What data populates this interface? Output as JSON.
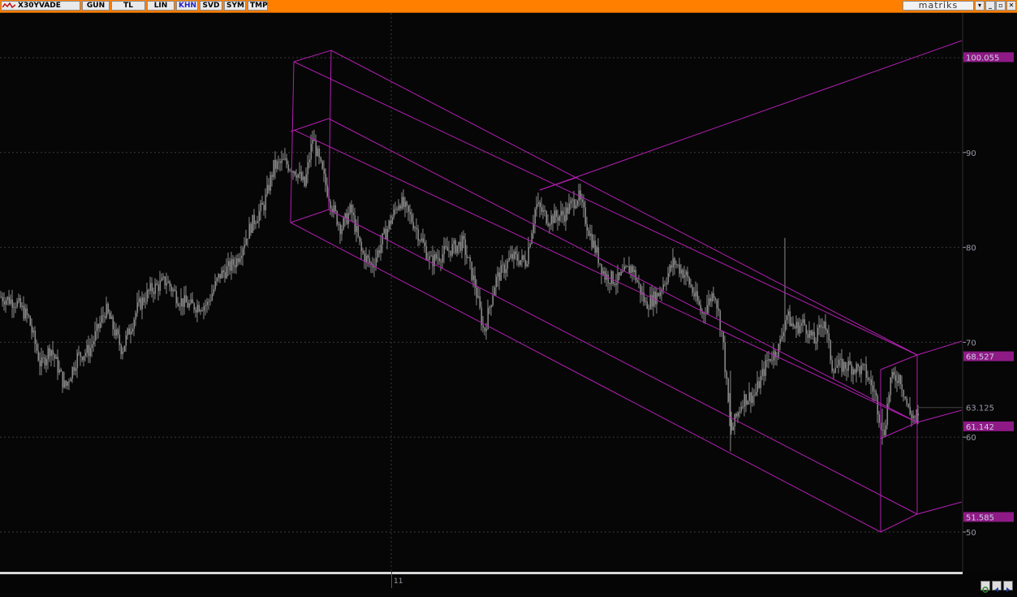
{
  "toolbar": {
    "symbol": "X30YVADE",
    "buttons": [
      {
        "label": "GUN",
        "active": false
      },
      {
        "label": "TL",
        "active": false
      },
      {
        "label": "LIN",
        "active": false
      },
      {
        "label": "KHN",
        "active": true
      },
      {
        "label": "SVD",
        "active": false
      },
      {
        "label": "SYM",
        "active": false
      },
      {
        "label": "TMP",
        "active": false
      }
    ],
    "brand": "matriks",
    "window_controls": [
      "▾",
      "_",
      "▫",
      "✕"
    ]
  },
  "chart_data": {
    "type": "candlestick",
    "ylim": [
      46,
      102
    ],
    "y_ticks": [
      "50",
      "60",
      "70",
      "80",
      "90",
      "100"
    ],
    "price_labels": [
      {
        "value": 100.055,
        "text": "100.055",
        "highlight": true
      },
      {
        "value": 68.527,
        "text": "68.527",
        "highlight": true
      },
      {
        "value": 63.125,
        "text": "63.125",
        "highlight": false
      },
      {
        "value": 61.142,
        "text": "61.142",
        "highlight": true
      },
      {
        "value": 51.585,
        "text": "51.585",
        "highlight": true
      }
    ],
    "x_label": "11",
    "colors": {
      "background": "#060606",
      "candles": "#8a8a8a",
      "channel": "#b21fb2",
      "grid": "#3a3a3a",
      "axis_text": "#9a9aa8",
      "label_bg": "#8e1a86",
      "toolbar": "#ff7f00"
    },
    "anchors": [
      [
        0,
        74.8
      ],
      [
        20,
        74.2
      ],
      [
        35,
        72.5
      ],
      [
        50,
        67.5
      ],
      [
        62,
        69.5
      ],
      [
        80,
        65.2
      ],
      [
        95,
        68.5
      ],
      [
        110,
        69.2
      ],
      [
        130,
        73.5
      ],
      [
        150,
        69.2
      ],
      [
        170,
        73.8
      ],
      [
        185,
        75.5
      ],
      [
        205,
        76.5
      ],
      [
        220,
        74.5
      ],
      [
        235,
        73.8
      ],
      [
        255,
        74.0
      ],
      [
        270,
        77.0
      ],
      [
        290,
        78.5
      ],
      [
        310,
        82.5
      ],
      [
        325,
        84.5
      ],
      [
        337,
        88.5
      ],
      [
        350,
        89.0
      ],
      [
        365,
        88.0
      ],
      [
        375,
        86.5
      ],
      [
        385,
        91.5
      ],
      [
        398,
        87.5
      ],
      [
        410,
        84.0
      ],
      [
        420,
        82.0
      ],
      [
        432,
        84.0
      ],
      [
        445,
        79.5
      ],
      [
        458,
        78.0
      ],
      [
        472,
        81.0
      ],
      [
        492,
        85.0
      ],
      [
        510,
        82.5
      ],
      [
        530,
        78.5
      ],
      [
        548,
        79.5
      ],
      [
        570,
        80.5
      ],
      [
        585,
        76.0
      ],
      [
        596,
        71.0
      ],
      [
        610,
        76.5
      ],
      [
        630,
        79.0
      ],
      [
        648,
        78.5
      ],
      [
        660,
        84.5
      ],
      [
        675,
        83.0
      ],
      [
        695,
        83.5
      ],
      [
        712,
        85.5
      ],
      [
        728,
        81.0
      ],
      [
        745,
        77.0
      ],
      [
        760,
        76.5
      ],
      [
        778,
        78.0
      ],
      [
        795,
        74.0
      ],
      [
        810,
        75.0
      ],
      [
        830,
        78.5
      ],
      [
        845,
        77.0
      ],
      [
        865,
        73.0
      ],
      [
        880,
        75.5
      ],
      [
        890,
        70.5
      ],
      [
        900,
        60.5
      ],
      [
        915,
        64.0
      ],
      [
        930,
        64.5
      ],
      [
        945,
        68.0
      ],
      [
        960,
        69.5
      ],
      [
        968,
        73.0
      ],
      [
        978,
        71.5
      ],
      [
        990,
        72.0
      ],
      [
        1003,
        70.0
      ],
      [
        1015,
        72.5
      ],
      [
        1025,
        67.5
      ],
      [
        1045,
        67.5
      ],
      [
        1065,
        67.0
      ],
      [
        1078,
        64.5
      ],
      [
        1088,
        60.0
      ],
      [
        1097,
        66.0
      ],
      [
        1108,
        66.5
      ],
      [
        1120,
        62.5
      ],
      [
        1132,
        61.8
      ]
    ],
    "spikes": [
      {
        "x": 967,
        "low": 72.0,
        "high": 81.0
      },
      {
        "x": 900,
        "low": 58.5,
        "high": 67.0
      },
      {
        "x": 1087,
        "low": 59.2,
        "high": 63.0
      }
    ]
  }
}
